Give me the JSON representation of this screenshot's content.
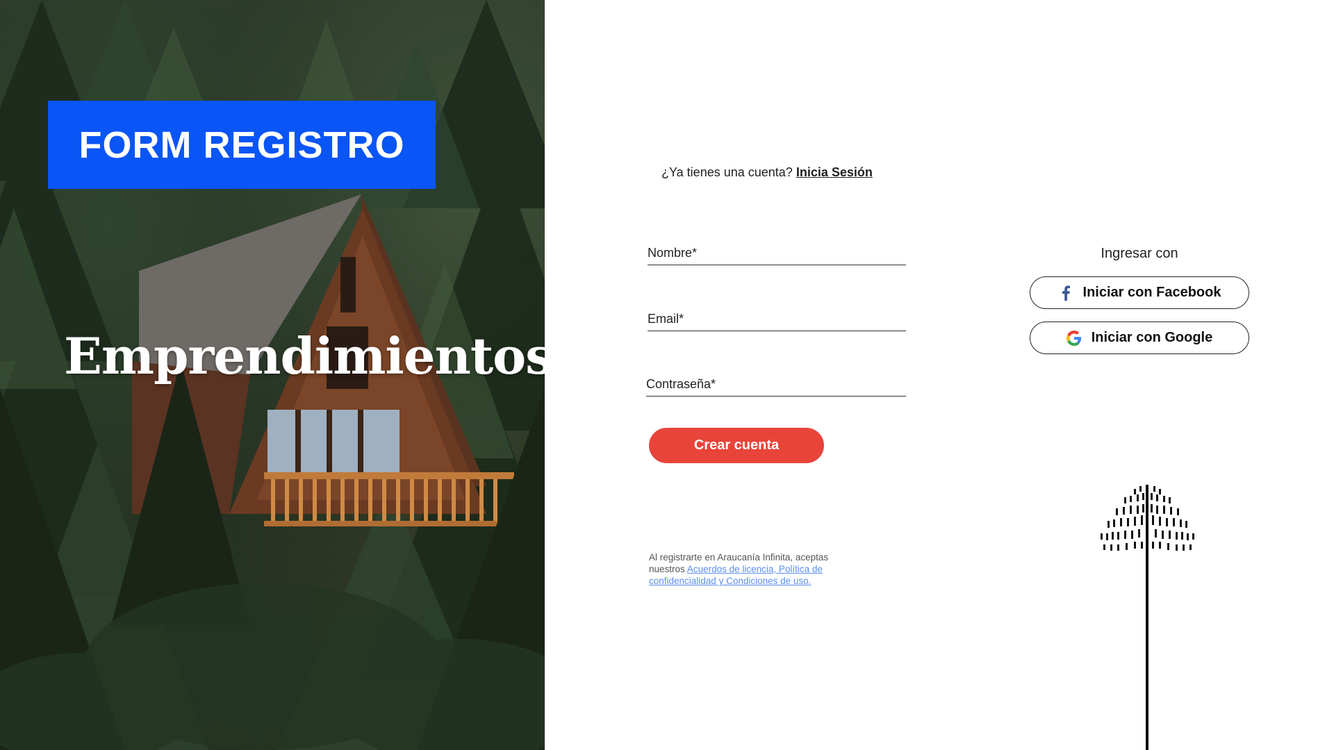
{
  "hero": {
    "badge": "FORM REGISTRO",
    "title": "Emprendimientos"
  },
  "form": {
    "login_prompt": "¿Ya tienes una cuenta?",
    "login_link": "Inicia Sesión",
    "fields": {
      "nombre": "Nombre*",
      "email": "Email*",
      "password": "Contraseña*"
    },
    "submit": "Crear cuenta",
    "legal": {
      "prefix": "Al registrarte en Araucanía Infinita, aceptas nuestros",
      "link": "Acuerdos de licencia, Política de confidencialidad y Condiciones de uso."
    }
  },
  "social": {
    "title": "Ingresar con",
    "facebook": "Iniciar con Facebook",
    "google": "Iniciar con Google"
  },
  "colors": {
    "badge": "#0a55f5",
    "primary_button": "#e8443a",
    "link": "#5b8ef0",
    "facebook": "#3b5998"
  },
  "icons": [
    "facebook-icon",
    "google-icon",
    "araucaria-tree-logo"
  ]
}
